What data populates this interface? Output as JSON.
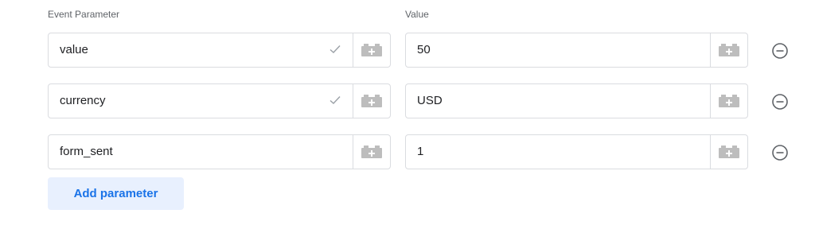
{
  "headers": {
    "parameter": "Event Parameter",
    "value": "Value"
  },
  "rows": [
    {
      "parameter": "value",
      "value": "50",
      "validated": true
    },
    {
      "parameter": "currency",
      "value": "USD",
      "validated": true
    },
    {
      "parameter": "form_sent",
      "value": "1",
      "validated": false
    }
  ],
  "icons": {
    "variable": "variable-picker-icon",
    "check": "check-icon",
    "remove": "remove-circle-icon"
  },
  "add_button_label": "Add parameter",
  "colors": {
    "accent": "#1a73e8",
    "accent_bg": "#e8f0fe",
    "border": "#dadce0",
    "icon_gray": "#bdbdbd"
  }
}
